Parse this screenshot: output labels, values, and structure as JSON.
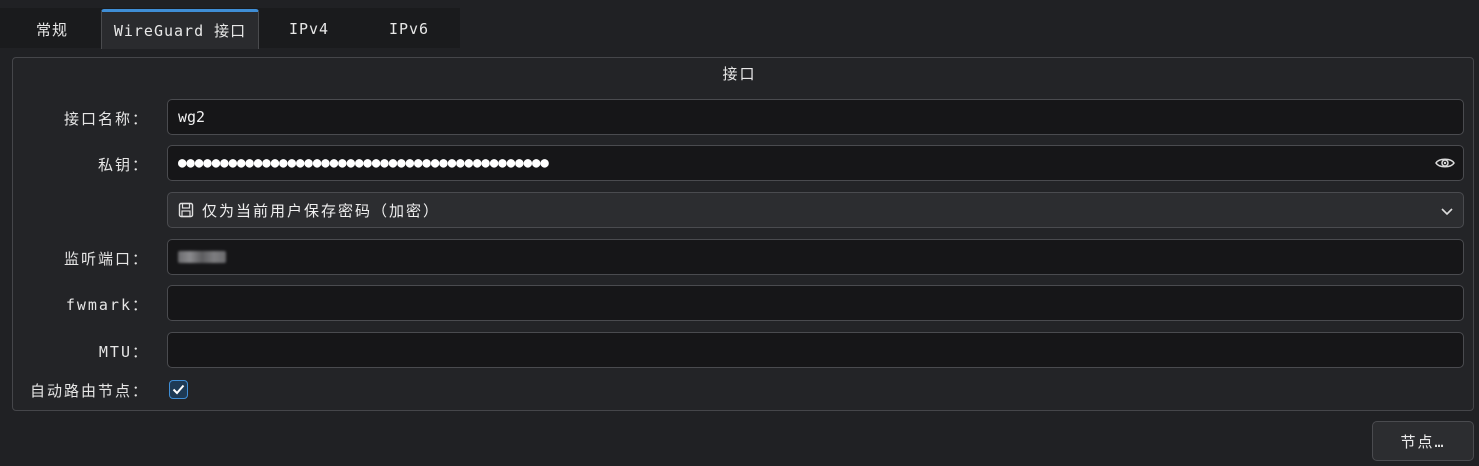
{
  "tabs": [
    {
      "label": "常规",
      "active": false
    },
    {
      "label": "WireGuard 接口",
      "active": true
    },
    {
      "label": "IPv4",
      "active": false
    },
    {
      "label": "IPv6",
      "active": false
    }
  ],
  "group": {
    "title": "接口",
    "interface_name": {
      "label": "接口名称：",
      "value": "wg2"
    },
    "private_key": {
      "label": "私钥：",
      "value": "●●●●●●●●●●●●●●●●●●●●●●●●●●●●●●●●●●●●●●●●●●●●",
      "icon": "eye-icon"
    },
    "password_storage": {
      "selected": "仅为当前用户保存密码（加密）",
      "icon": "floppy-icon"
    },
    "listen_port": {
      "label": "监听端口：",
      "value": ""
    },
    "fwmark": {
      "label": "fwmark：",
      "value": ""
    },
    "mtu": {
      "label": "MTU：",
      "value": ""
    },
    "auto_route": {
      "label": "自动路由节点：",
      "checked": true
    }
  },
  "buttons": {
    "nodes": "节点…"
  },
  "colors": {
    "accent": "#3f8ed6",
    "background": "#202124",
    "field_bg": "#161618"
  }
}
